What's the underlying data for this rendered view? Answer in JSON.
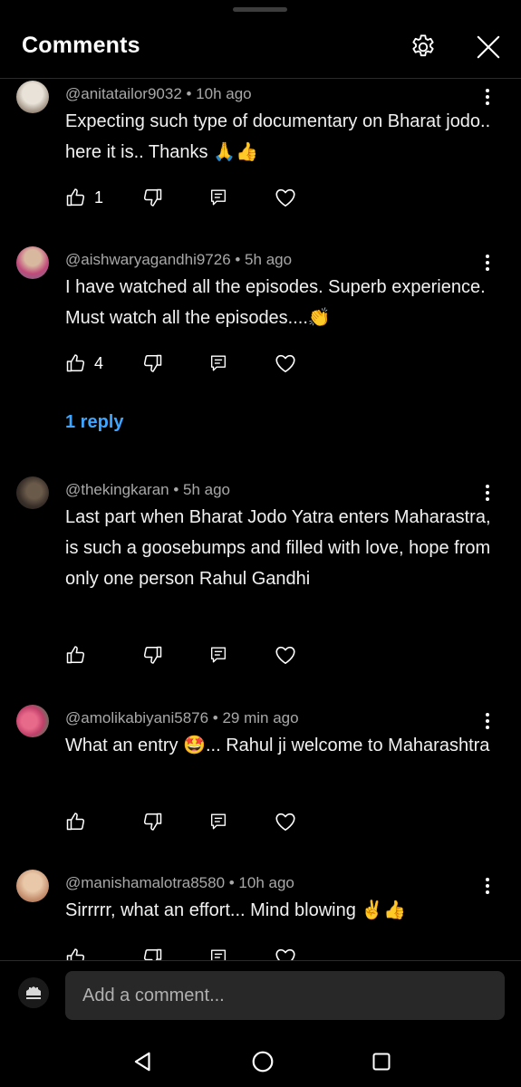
{
  "header": {
    "title": "Comments"
  },
  "comments": [
    {
      "author": "@anitatailor9032",
      "time": "10h ago",
      "meta": "@anitatailor9032 • 10h ago",
      "text": "Expecting such type of documentary on Bharat jodo.. here it is.. Thanks 🙏👍",
      "likes": "1",
      "avatar_colors": [
        "#d8d3c8",
        "#8a7a6a"
      ]
    },
    {
      "author": "@aishwaryagandhi9726",
      "time": "5h ago",
      "meta": "@aishwaryagandhi9726 • 5h ago",
      "text": "I have watched all the episodes. Superb experience. Must watch all the episodes....👏",
      "likes": "4",
      "replies_label": "1 reply",
      "avatar_colors": [
        "#c9a08a",
        "#d04a7a"
      ]
    },
    {
      "author": "@thekingkaran",
      "time": "5h ago",
      "meta": "@thekingkaran • 5h ago",
      "text": "Last part when Bharat Jodo Yatra enters Maharastra, is such a goosebumps and filled with love, hope from only one person Rahul Gandhi",
      "likes": "",
      "avatar_colors": [
        "#5a4a3a",
        "#2a2420"
      ]
    },
    {
      "author": "@amolikabiyani5876",
      "time": "29 min ago",
      "meta": "@amolikabiyani5876 • 29 min ago",
      "text": "What an entry 🤩... Rahul ji welcome to Maharashtra",
      "likes": "",
      "avatar_colors": [
        "#e0607a",
        "#3a8a5a"
      ]
    },
    {
      "author": "@manishamalotra8580",
      "time": "10h ago",
      "meta": "@manishamalotra8580 • 10h ago",
      "text": "Sirrrrr, what an effort... Mind blowing ✌️👍",
      "likes": "",
      "avatar_colors": [
        "#d9b08c",
        "#b07050"
      ]
    }
  ],
  "compose": {
    "placeholder": "Add a comment..."
  },
  "icons": {
    "settings": "gear-icon",
    "close": "close-icon",
    "like": "thumbs-up-icon",
    "dislike": "thumbs-down-icon",
    "reply": "reply-icon",
    "heart": "heart-icon",
    "more": "more-vertical-icon",
    "nav_back": "back-triangle-icon",
    "nav_home": "home-circle-icon",
    "nav_recents": "recents-square-icon"
  },
  "colors": {
    "background": "#000000",
    "link": "#3ea6ff",
    "meta": "#a8a8a8",
    "input": "#282828"
  }
}
